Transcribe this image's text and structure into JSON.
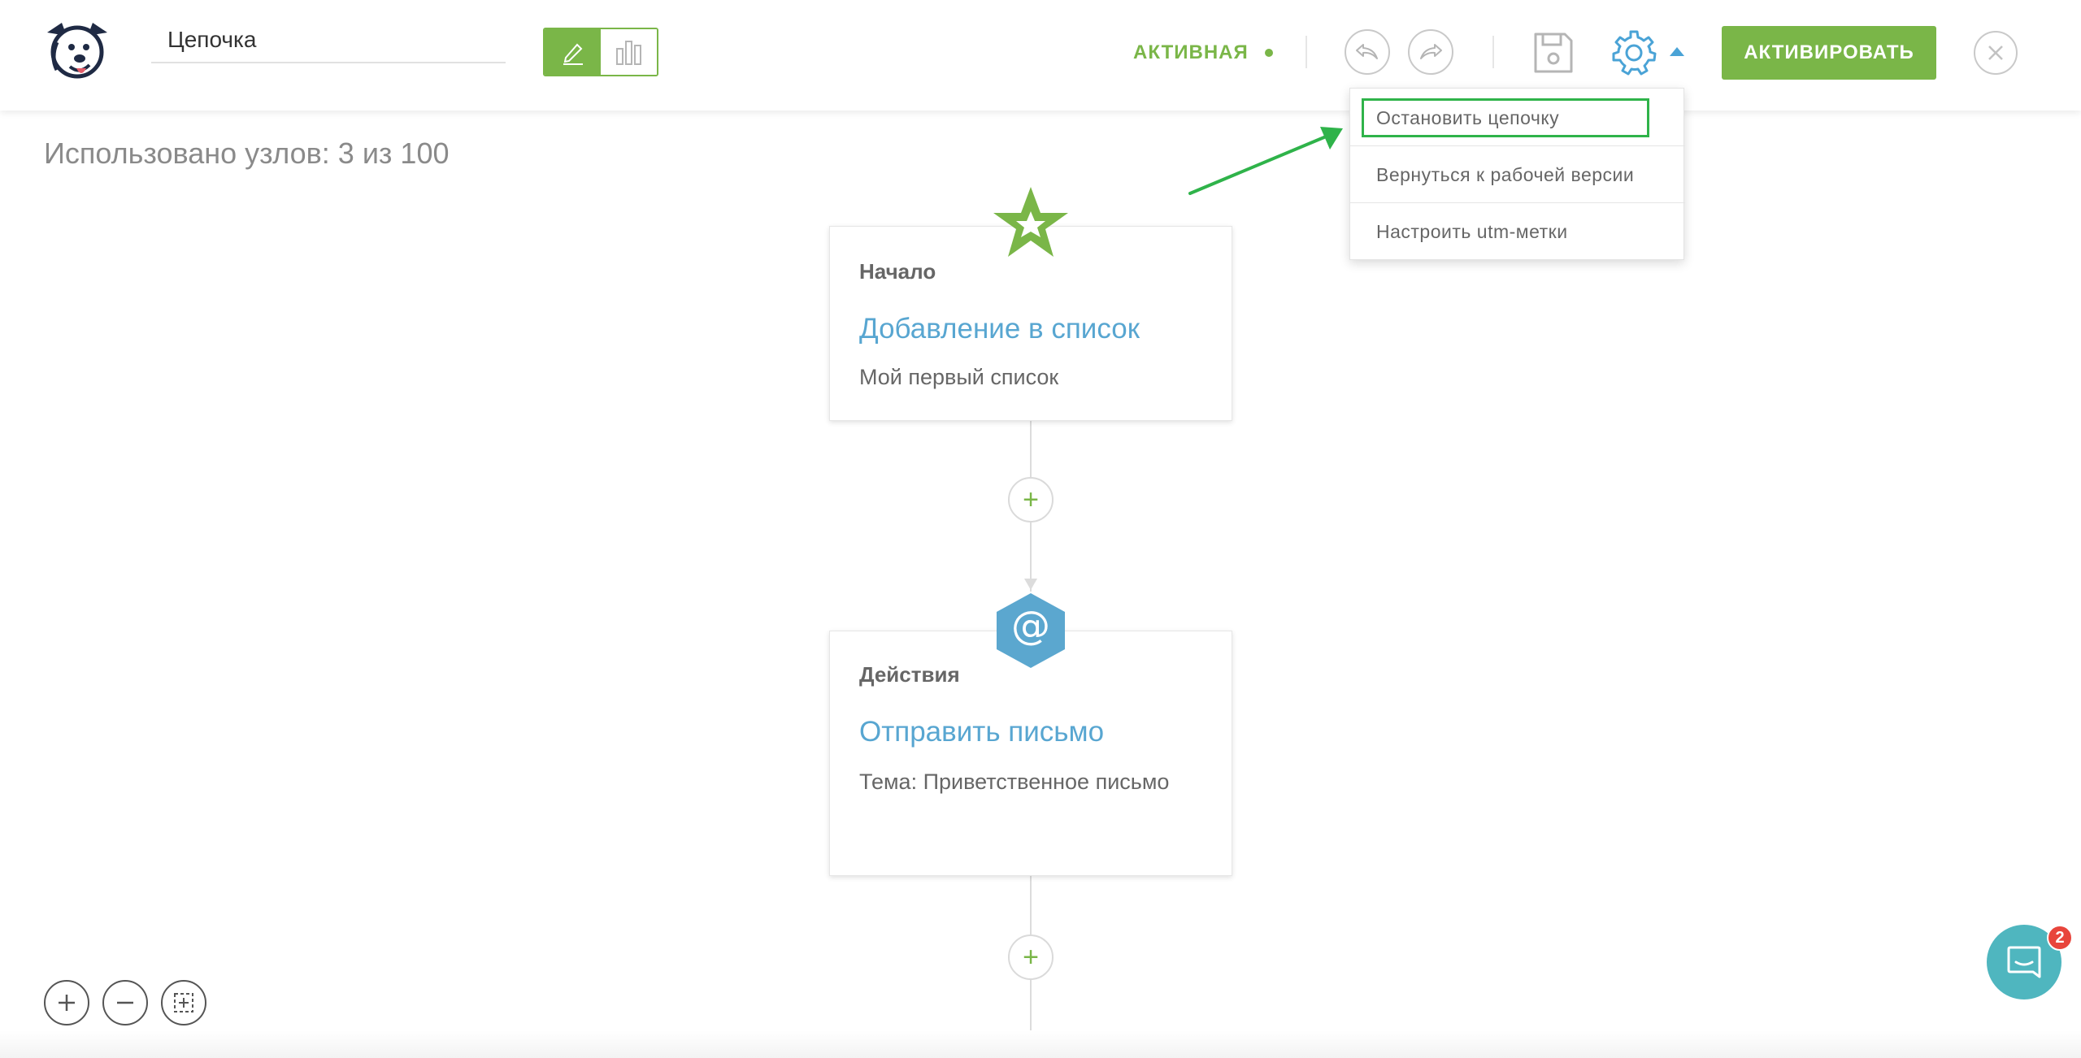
{
  "header": {
    "chain_name_value": "Цепочка",
    "status_label": "АКТИВНАЯ",
    "activate_label": "АКТИВИРОВАТЬ"
  },
  "colors": {
    "accent_green": "#7ab648",
    "link_blue": "#58a6d1",
    "highlight_green": "#2fb34a",
    "action_hex_blue": "#5ba7cf"
  },
  "nodes_used_text": "Использовано узлов: 3 из 100",
  "settings_menu": {
    "items": [
      {
        "label": "Остановить цепочку"
      },
      {
        "label": "Вернуться к рабочей версии"
      },
      {
        "label": "Настроить utm-метки"
      }
    ]
  },
  "flow": {
    "start_card": {
      "kicker": "Начало",
      "title": "Добавление в список",
      "subtitle": "Мой первый список"
    },
    "action_card": {
      "kicker": "Действия",
      "title": "Отправить письмо",
      "subtitle": "Тема: Приветственное письмо",
      "icon_glyph": "@"
    },
    "add_glyph": "+"
  },
  "chat": {
    "badge_count": "2"
  },
  "icons": [
    "dog-logo-icon",
    "pencil-icon",
    "bar-chart-icon",
    "undo-icon",
    "redo-icon",
    "save-icon",
    "gear-icon",
    "close-icon",
    "star-icon",
    "at-icon",
    "zoom-in-icon",
    "zoom-out-icon",
    "fit-screen-icon",
    "chat-icon"
  ]
}
